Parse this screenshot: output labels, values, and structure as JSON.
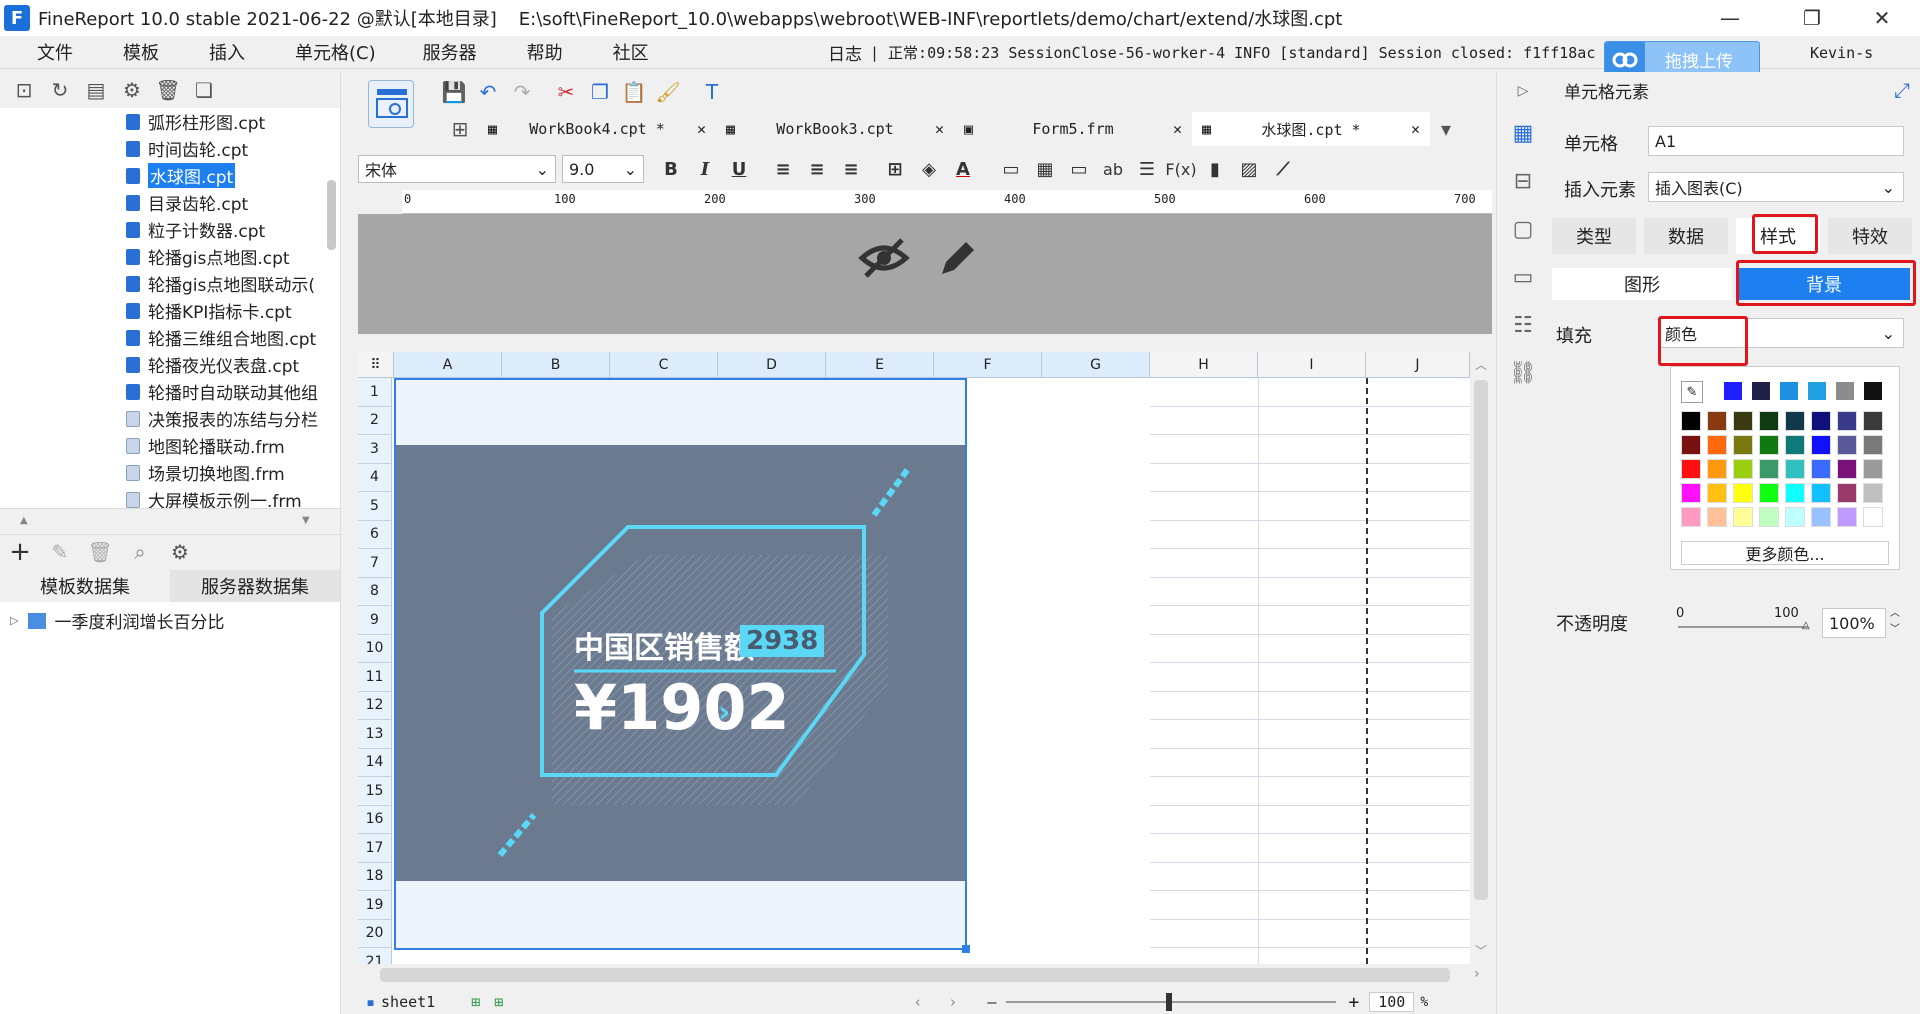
{
  "window": {
    "title": "FineReport 10.0 stable 2021-06-22 @默认[本地目录]",
    "path": "E:\\soft\\FineReport_10.0\\webapps\\webroot\\WEB-INF\\reportlets/demo/chart/extend/水球图.cpt"
  },
  "menu": {
    "items": [
      "文件",
      "模板",
      "插入",
      "单元格(C)",
      "服务器",
      "帮助",
      "社区"
    ]
  },
  "log": {
    "label": "日志",
    "text": "| 正常:09:58:23 SessionClose-56-worker-4 INFO [standard] Session closed: f1ff18ac"
  },
  "upload": {
    "label": "拖拽上传"
  },
  "user": {
    "name": "Kevin-s"
  },
  "file_tree": {
    "items": [
      {
        "label": "弧形柱形图.cpt",
        "type": "cpt"
      },
      {
        "label": "时间齿轮.cpt",
        "type": "cpt"
      },
      {
        "label": "水球图.cpt",
        "type": "cpt",
        "selected": true
      },
      {
        "label": "目录齿轮.cpt",
        "type": "cpt"
      },
      {
        "label": "粒子计数器.cpt",
        "type": "cpt"
      },
      {
        "label": "轮播gis点地图.cpt",
        "type": "cpt"
      },
      {
        "label": "轮播gis点地图联动示(",
        "type": "cpt"
      },
      {
        "label": "轮播KPI指标卡.cpt",
        "type": "cpt"
      },
      {
        "label": "轮播三维组合地图.cpt",
        "type": "cpt"
      },
      {
        "label": "轮播夜光仪表盘.cpt",
        "type": "cpt"
      },
      {
        "label": "轮播时自动联动其他组",
        "type": "cpt"
      },
      {
        "label": "决策报表的冻结与分栏",
        "type": "frm"
      },
      {
        "label": "地图轮播联动.frm",
        "type": "frm"
      },
      {
        "label": "场景切换地图.frm",
        "type": "frm"
      },
      {
        "label": "大屏模板示例一.frm",
        "type": "frm"
      }
    ]
  },
  "dataset": {
    "tabs": [
      "模板数据集",
      "服务器数据集"
    ],
    "items": [
      "一季度利润增长百分比"
    ]
  },
  "doc_tabs": [
    {
      "label": "WorkBook4.cpt *"
    },
    {
      "label": "WorkBook3.cpt"
    },
    {
      "label": "Form5.frm"
    },
    {
      "label": "水球图.cpt *",
      "active": true
    }
  ],
  "format": {
    "font": "宋体",
    "size": "9.0",
    "bold": "B",
    "italic": "I",
    "underline": "U",
    "ab": "ab",
    "fx": "F(x)"
  },
  "ruler": {
    "ticks": [
      "0",
      "100",
      "200",
      "300",
      "400",
      "500",
      "600",
      "700"
    ]
  },
  "sheet": {
    "columns": [
      "A",
      "B",
      "C",
      "D",
      "E",
      "F",
      "G",
      "H",
      "I",
      "J"
    ],
    "rows": [
      "1",
      "2",
      "3",
      "4",
      "5",
      "6",
      "7",
      "8",
      "9",
      "10",
      "11",
      "12",
      "13",
      "14",
      "15",
      "16",
      "17",
      "18",
      "19",
      "20",
      "21"
    ],
    "name": "sheet1",
    "zoom": "100",
    "zoom_unit": "%"
  },
  "chart_cell": {
    "title": "中国区销售额",
    "badge": "2938",
    "value": "¥1902",
    "arrow": "›"
  },
  "colors": {
    "accent": "#1e7ff0",
    "chart_bg": "#6b7a8f",
    "neon": "#5ad8f5",
    "highlight": "#e0161e"
  },
  "props": {
    "header": "单元格元素",
    "cell_label": "单元格",
    "cell_value": "A1",
    "insert_label": "插入元素",
    "insert_value": "插入图表(C)",
    "tabs": [
      "类型",
      "数据",
      "样式",
      "特效"
    ],
    "subtabs": [
      "图形",
      "背景"
    ],
    "fill_label": "填充",
    "fill_value": "颜色",
    "more_colors": "更多颜色...",
    "opacity_label": "不透明度",
    "opacity_min": "0",
    "opacity_max": "100",
    "opacity_value": "100%"
  }
}
